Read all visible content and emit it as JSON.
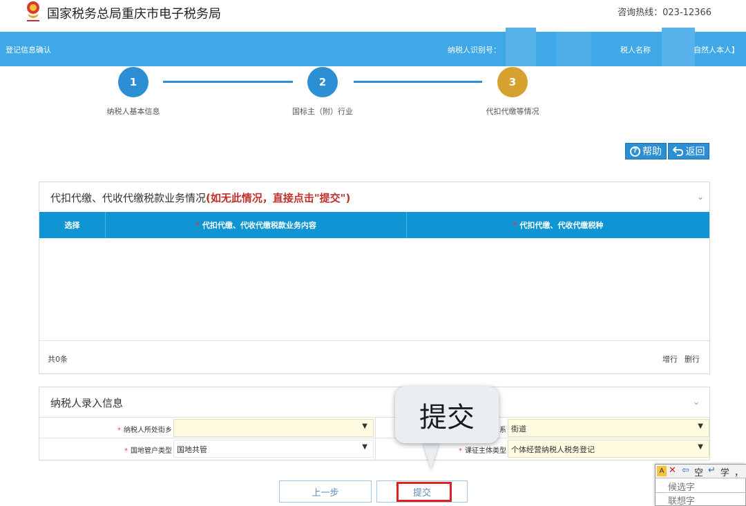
{
  "header": {
    "site_title": "国家税务总局重庆市电子税务局",
    "hotline": "咨询热线：023-12366"
  },
  "nav_bar": {
    "page_name": "登记信息确认",
    "taxpayer_id_label": "纳税人识别号：",
    "taxpayer_name_label": "税人名称",
    "taxpayer_name_suffix": "自然人本人】"
  },
  "steps": [
    {
      "number": "1",
      "label": "纳税人基本信息",
      "state": "done",
      "color": "#2c8fd3"
    },
    {
      "number": "2",
      "label": "国标主（附）行业",
      "state": "done",
      "color": "#2c8fd3"
    },
    {
      "number": "3",
      "label": "代扣代缴等情况",
      "state": "current",
      "color": "#d6a12f"
    }
  ],
  "actions": {
    "help_label": "帮助",
    "back_label": "返回"
  },
  "withholding_panel": {
    "title": "代扣代缴、代收代缴税款业务情况",
    "title_note": "(如无此情况，直接点击\"提交\")",
    "columns": [
      "选择",
      "代扣代缴、代收代缴税款业务内容",
      "代扣代缴、代收代缴税种"
    ],
    "rows": [],
    "total_label": "共0条",
    "add_row_label": "增行",
    "delete_row_label": "删行"
  },
  "taxpayer_panel": {
    "title": "纳税人录入信息",
    "fields": [
      {
        "label": "纳税人所处街乡",
        "value": ""
      },
      {
        "label": "系",
        "value": "街道"
      },
      {
        "label": "国地管户类型",
        "value": "国地共管"
      },
      {
        "label": "课征主体类型",
        "value": "个体经营纳税人税务登记"
      }
    ]
  },
  "footer_buttons": {
    "prev_label": "上一步",
    "submit_label": "提交"
  },
  "callout": {
    "text": "提交"
  },
  "ime": {
    "toolbar": [
      "✕",
      "⇦",
      "空",
      "↵",
      "学",
      "，"
    ],
    "candidate_label": "候选字",
    "association_label": "联想字"
  },
  "colors": {
    "bar_blue": "#3fa8e6",
    "table_header": "#0f95d4",
    "step_blue": "#2c8fd3",
    "step_gold": "#d6a12f",
    "highlight_red": "#e02020"
  }
}
